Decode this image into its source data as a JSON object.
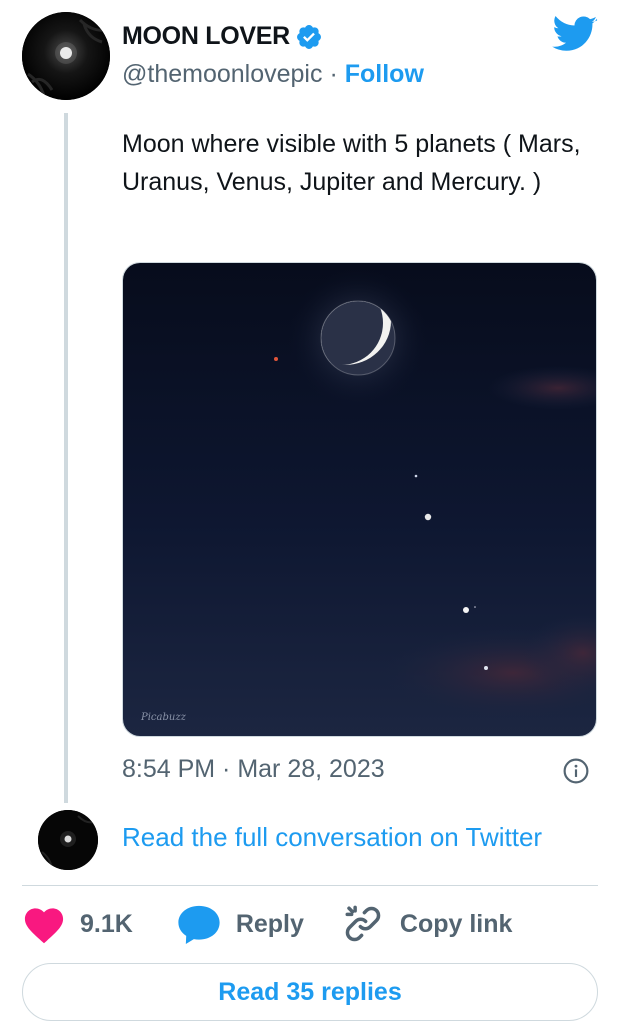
{
  "author": {
    "name": "MOON LOVER",
    "handle": "@themoonlovepic",
    "separator": "·",
    "follow_label": "Follow"
  },
  "tweet": {
    "text": "Moon where visible with 5 planets ( Mars, Uranus, Venus, Jupiter and Mercury. )",
    "image_watermark": "Picabuzz",
    "timestamp": "8:54 PM · Mar 28, 2023"
  },
  "conversation": {
    "read_full_label": "Read the full conversation on Twitter"
  },
  "actions": {
    "like_count": "9.1K",
    "reply_label": "Reply",
    "copy_link_label": "Copy link"
  },
  "footer": {
    "read_replies_label": "Read 35 replies"
  },
  "icons": {
    "verified": "verified-badge-icon",
    "twitter": "twitter-bird-icon",
    "info": "info-icon",
    "like": "heart-icon",
    "reply": "speech-bubble-icon",
    "copy_link": "link-icon"
  },
  "colors": {
    "accent": "#1d9bf0",
    "like": "#f91880",
    "secondary_text": "#536471",
    "border": "#cfd9de"
  }
}
